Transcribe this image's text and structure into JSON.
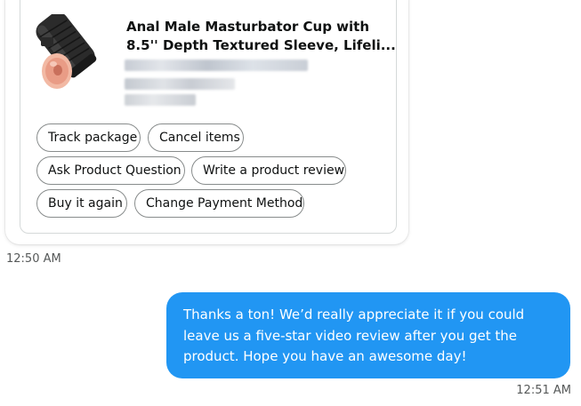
{
  "incoming": {
    "product": {
      "title_line1": "Anal Male Masturbator Cup with",
      "title_line2": "8.5'' Depth Textured Sleeve, Lifeli..."
    },
    "actions": {
      "track": "Track package",
      "cancel": "Cancel items",
      "ask": "Ask Product Question",
      "review": "Write a product review",
      "buy_again": "Buy it again",
      "payment": "Change Payment Method"
    },
    "timestamp": "12:50 AM"
  },
  "outgoing": {
    "line1": "Thanks a ton! We’d really appreciate it if you could",
    "line2": "leave us a five-star video review after you get the",
    "line3": "product. Hope you have an awesome day!",
    "timestamp": "12:51 AM",
    "bubble_color": "#2196f3"
  }
}
